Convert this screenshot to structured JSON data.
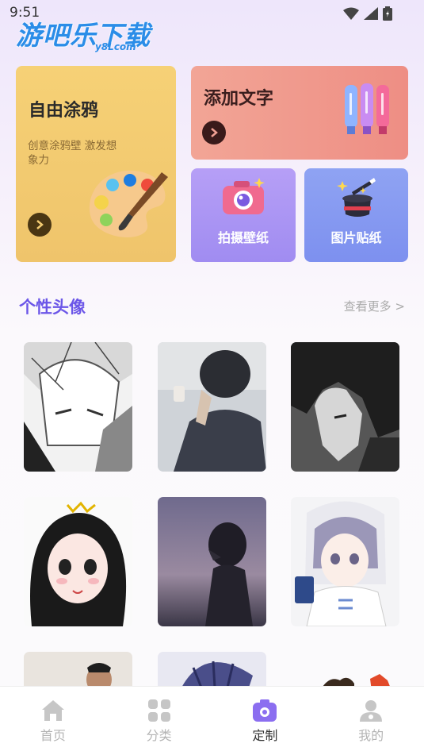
{
  "status_bar": {
    "time": "9:51"
  },
  "watermark": {
    "main": "游吧乐下载",
    "sub": "y8Lcom"
  },
  "cards": {
    "graffiti": {
      "title": "自由涂鸦",
      "subtitle": "创意涂鸦壁 激发想象力"
    },
    "add_text": {
      "title": "添加文字"
    },
    "photo_wallpaper": {
      "title": "拍摄壁纸"
    },
    "image_sticker": {
      "title": "图片贴纸"
    }
  },
  "section": {
    "title": "个性头像",
    "more": "查看更多 >"
  },
  "tabs": [
    {
      "label": "首页",
      "icon": "home-icon",
      "active": false
    },
    {
      "label": "分类",
      "icon": "grid-icon",
      "active": false
    },
    {
      "label": "定制",
      "icon": "camera-icon",
      "active": true
    },
    {
      "label": "我的",
      "icon": "user-icon",
      "active": false
    }
  ],
  "colors": {
    "accent": "#6b56e8",
    "graffiti_card": "#f3cb72",
    "text_card": "#f09a8e",
    "photo_card": "#ac96f4",
    "sticker_card": "#8799f1"
  }
}
